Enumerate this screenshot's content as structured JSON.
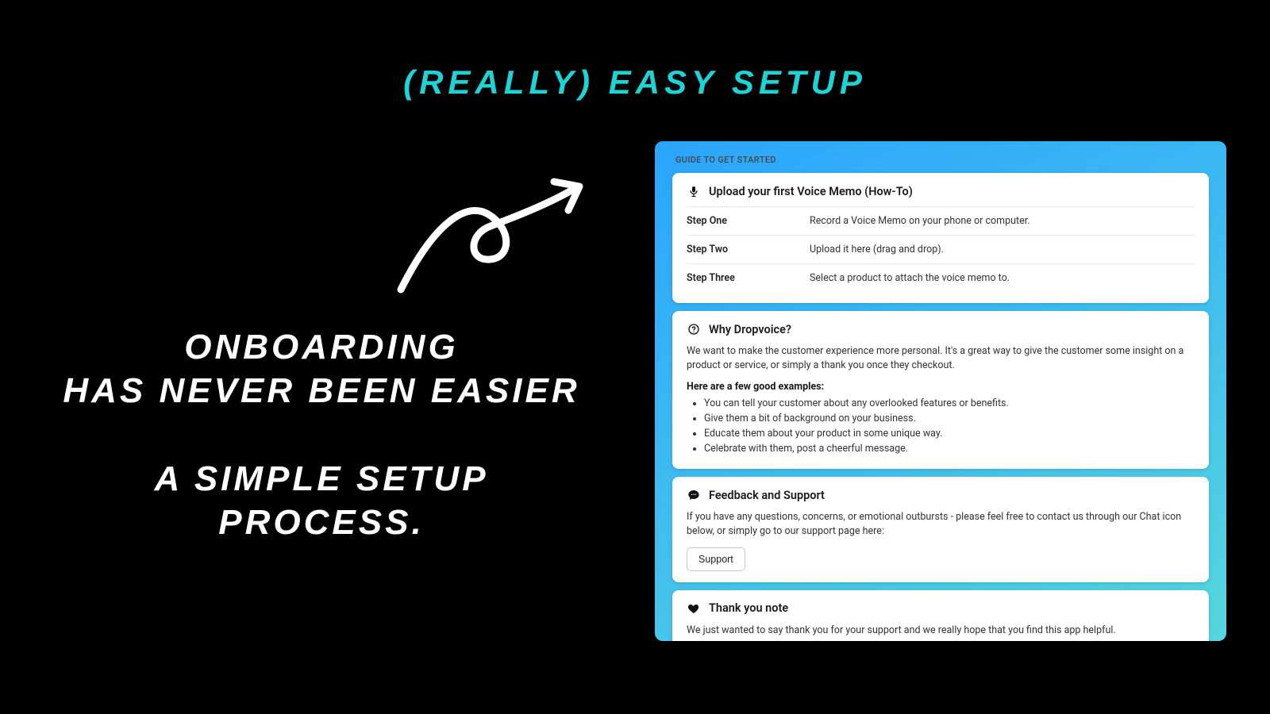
{
  "hero": {
    "title": "(REALLY)  EASY  SETUP"
  },
  "copy": {
    "line1": "ONBOARDING",
    "line2": "HAS  NEVER  BEEN  EASIER",
    "line3": "A  SIMPLE  SETUP",
    "line4": "PROCESS."
  },
  "panel": {
    "guide_label": "GUIDE TO GET STARTED",
    "howto": {
      "title": "Upload your first Voice Memo (How-To)",
      "steps": [
        {
          "label": "Step One",
          "desc": "Record a Voice Memo on your phone or computer."
        },
        {
          "label": "Step Two",
          "desc": "Upload it here (drag and drop)."
        },
        {
          "label": "Step Three",
          "desc": "Select a product to attach the voice memo to."
        }
      ]
    },
    "why": {
      "title": "Why Dropvoice?",
      "intro": "We want to make the customer experience more personal. It's a great way to give the customer some insight on a product or service, or simply a thank you once they checkout.",
      "examples_label": "Here are a few good examples:",
      "examples": [
        "You can tell your customer about any overlooked features or benefits.",
        "Give them a bit of background on your business.",
        "Educate them about your product in some unique way.",
        "Celebrate with them, post a cheerful message."
      ]
    },
    "feedback": {
      "title": "Feedback and Support",
      "body": "If you have any questions, concerns, or emotional outbursts - please feel free to contact us through our Chat icon below, or simply go to our support page here:",
      "button": "Support"
    },
    "thanks": {
      "title": "Thank you note",
      "body": "We just wanted to say thank you for your support and we really hope that you find this app helpful."
    }
  }
}
